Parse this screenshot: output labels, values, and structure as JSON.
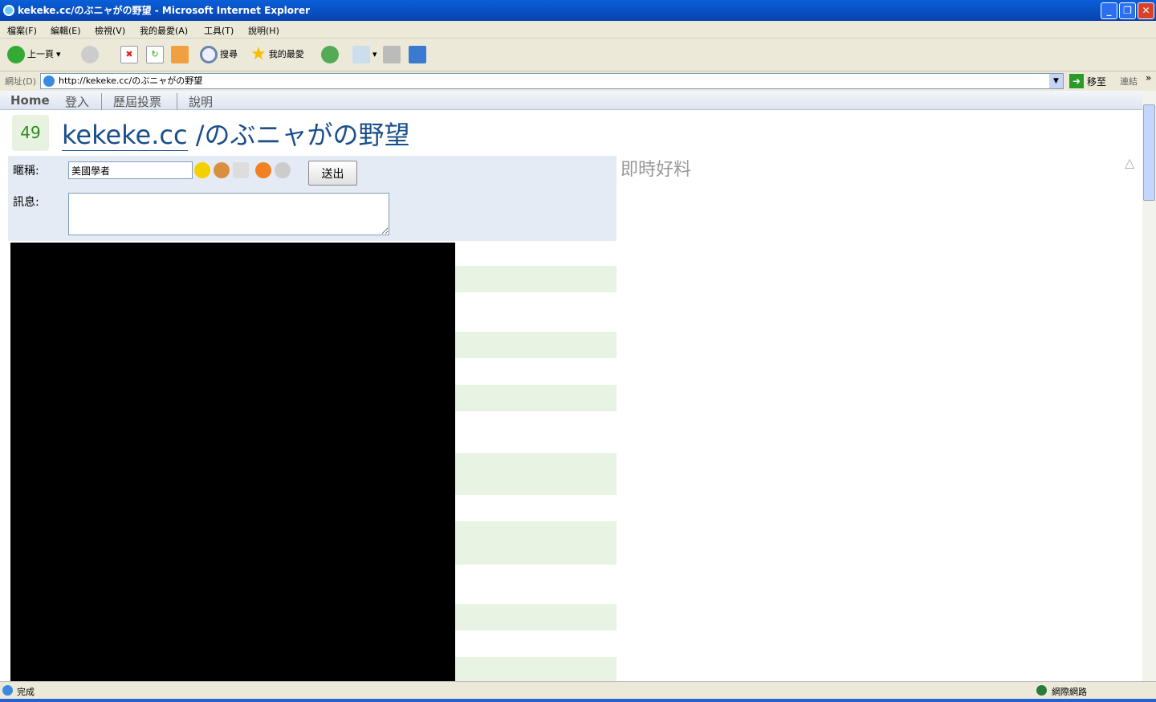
{
  "window": {
    "title": "kekeke.cc/のぶニャがの野望 - Microsoft Internet Explorer",
    "minimize": "_",
    "restore": "❐",
    "close": "✕"
  },
  "menu": [
    "檔案(F)",
    "編輯(E)",
    "檢視(V)",
    "我的最愛(A)",
    "工具(T)",
    "說明(H)"
  ],
  "toolbar": {
    "back": "上一頁",
    "search": "搜尋",
    "favorites": "我的最愛"
  },
  "address": {
    "label": "網址(D)",
    "url": "http://kekeke.cc/のぶニャがの野望",
    "go": "移至",
    "links": "連結",
    "more": "»"
  },
  "nav": [
    "Home",
    "登入",
    "歷屆投票",
    "說明"
  ],
  "header": {
    "count": "49",
    "site": "kekeke.cc",
    "room": " /のぶニャがの野望"
  },
  "form": {
    "nick_label": "暱稱:",
    "nick_value": "美國學者",
    "msg_label": "訊息:",
    "msg_value": "",
    "send": "送出"
  },
  "right": {
    "title": "即時好料"
  },
  "status": {
    "text": "完成",
    "zone": "網際網路"
  },
  "colors": {
    "accent": "#1a4f8a",
    "stripe": "#e9f3e4",
    "form_bg": "#e4ebf5"
  }
}
